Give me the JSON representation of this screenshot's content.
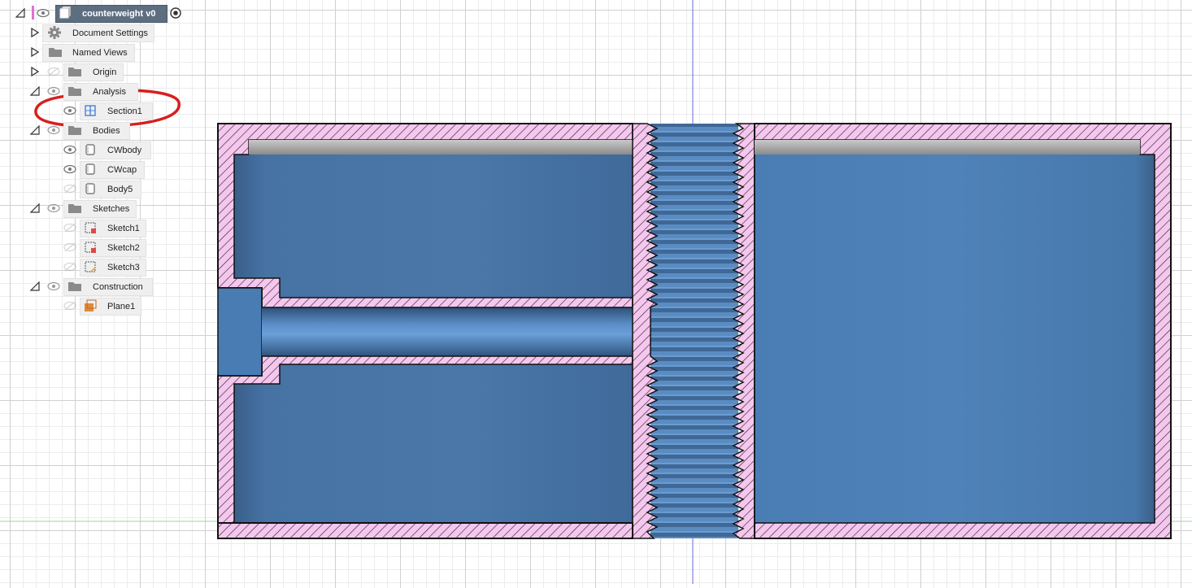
{
  "app": {
    "component_name": "counterweight v0"
  },
  "browser": {
    "items": [
      {
        "label": "Document Settings",
        "icon": "gear-icon",
        "expanded": false
      },
      {
        "label": "Named Views",
        "icon": "folder-icon",
        "expanded": false
      },
      {
        "label": "Origin",
        "icon": "folder-icon",
        "expanded": false,
        "visible": false
      },
      {
        "label": "Analysis",
        "icon": "folder-icon",
        "expanded": true,
        "visible": true
      },
      {
        "label": "Section1",
        "icon": "section-analysis-icon",
        "visible": true
      },
      {
        "label": "Bodies",
        "icon": "folder-icon",
        "expanded": true,
        "visible": true
      },
      {
        "label": "CWbody",
        "icon": "body-icon",
        "visible": true
      },
      {
        "label": "CWcap",
        "icon": "body-icon",
        "visible": true
      },
      {
        "label": "Body5",
        "icon": "body-icon",
        "visible": false
      },
      {
        "label": "Sketches",
        "icon": "folder-icon",
        "expanded": true,
        "visible": true
      },
      {
        "label": "Sketch1",
        "icon": "sketch-icon",
        "visible": false
      },
      {
        "label": "Sketch2",
        "icon": "sketch-icon",
        "visible": false
      },
      {
        "label": "Sketch3",
        "icon": "sketch-icon",
        "visible": false
      },
      {
        "label": "Construction",
        "icon": "folder-icon",
        "expanded": true,
        "visible": true
      },
      {
        "label": "Plane1",
        "icon": "construction-plane-icon",
        "visible": false
      }
    ]
  },
  "colors": {
    "section_fill": "#f5c6ee",
    "body_blue": "#4a7aae",
    "highlight_circle": "#d81e1e",
    "axis_line": "#6a6ae0"
  }
}
